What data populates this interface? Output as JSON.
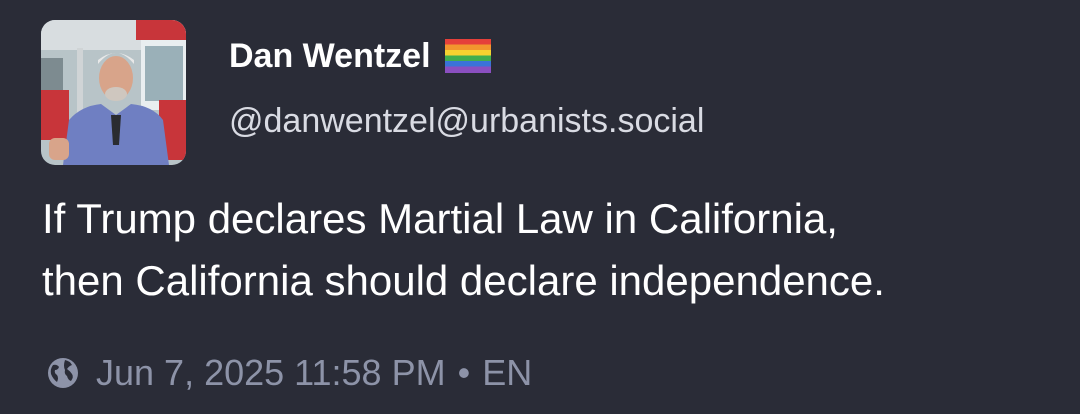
{
  "post": {
    "author": {
      "display_name": "Dan Wentzel",
      "badge_icon": "rainbow-flag-icon",
      "handle": "@danwentzel@urbanists.social"
    },
    "content": {
      "lines": [
        "If Trump declares Martial Law in California,",
        "then California should declare independence."
      ]
    },
    "meta": {
      "visibility_icon": "globe-icon",
      "timestamp": "Jun 7, 2025 11:58 PM",
      "separator": "•",
      "language": "EN"
    }
  },
  "colors": {
    "background": "#2a2c37",
    "text": "#ffffff",
    "muted": "#8d93a8"
  }
}
